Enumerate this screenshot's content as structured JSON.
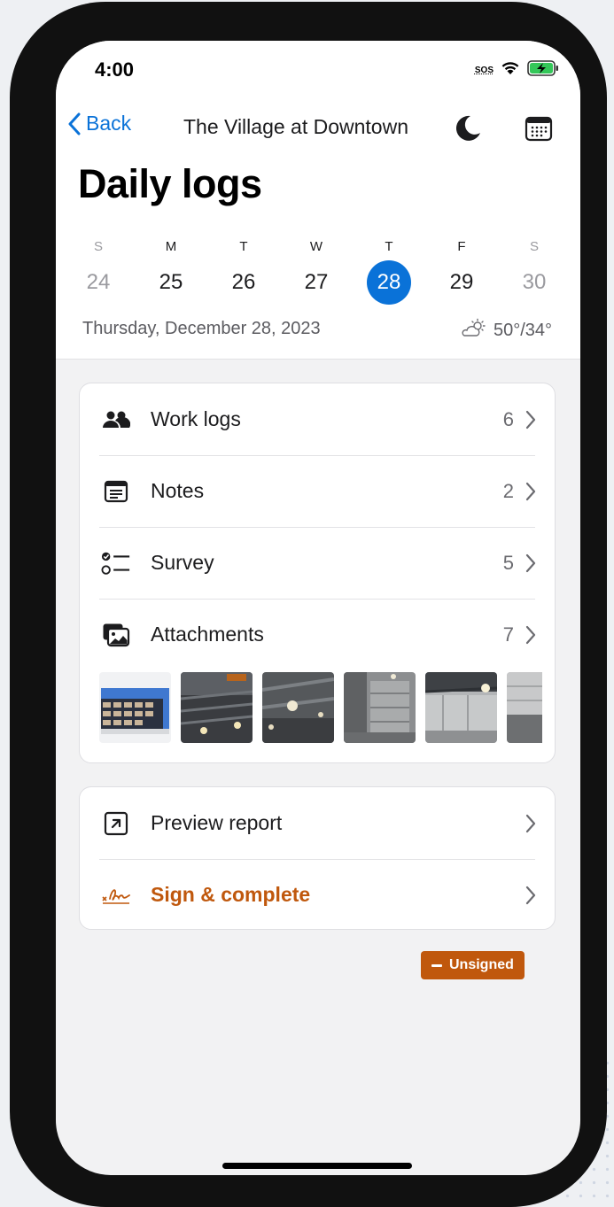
{
  "status": {
    "time": "4:00",
    "sos": "SOS"
  },
  "nav": {
    "back_label": "Back",
    "title": "The Village at Downtown",
    "night_icon": "moon-icon",
    "calendar_icon": "calendar-icon"
  },
  "header": {
    "title": "Daily logs"
  },
  "week": {
    "days": [
      {
        "dow": "S",
        "num": "24"
      },
      {
        "dow": "M",
        "num": "25"
      },
      {
        "dow": "T",
        "num": "26"
      },
      {
        "dow": "W",
        "num": "27"
      },
      {
        "dow": "T",
        "num": "28"
      },
      {
        "dow": "F",
        "num": "29"
      },
      {
        "dow": "S",
        "num": "30"
      }
    ],
    "selected_index": 4,
    "selected_color": "#0a72d8"
  },
  "date_line": "Thursday, December 28, 2023",
  "weather": {
    "icon": "partly-cloudy-icon",
    "temps": "50°/34°"
  },
  "sections": {
    "items": [
      {
        "label": "Work logs",
        "count": "6",
        "icon": "people-icon"
      },
      {
        "label": "Notes",
        "count": "2",
        "icon": "notes-icon"
      },
      {
        "label": "Survey",
        "count": "5",
        "icon": "checklist-icon"
      },
      {
        "label": "Attachments",
        "count": "7",
        "icon": "photos-icon"
      }
    ]
  },
  "actions": {
    "preview_label": "Preview report",
    "sign_label": "Sign & complete",
    "sign_color": "#c0580d"
  },
  "status_badge": {
    "label": "Unsigned",
    "color": "#c0580d"
  }
}
